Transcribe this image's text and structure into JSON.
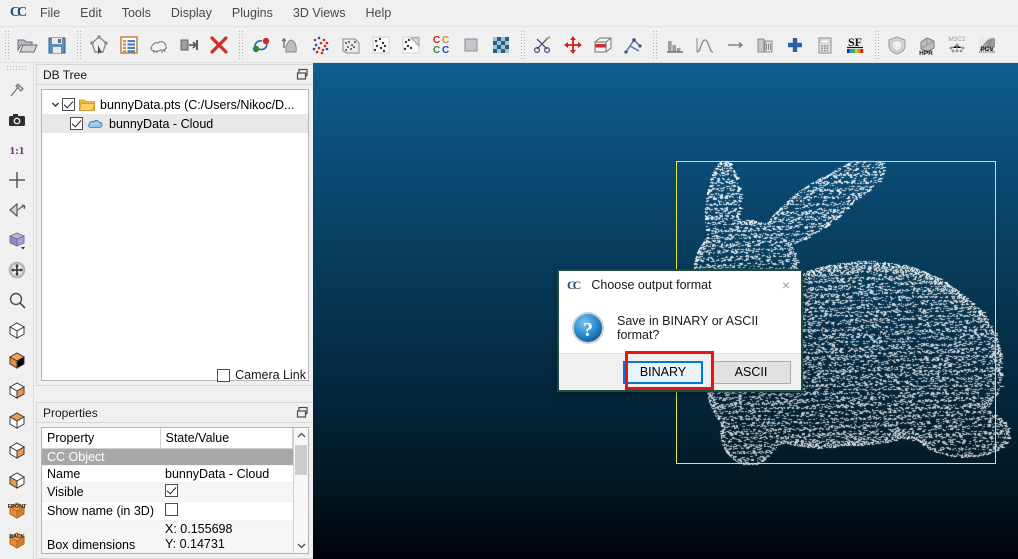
{
  "app": {
    "logo": "CC",
    "menu": [
      "File",
      "Edit",
      "Tools",
      "Display",
      "Plugins",
      "3D Views",
      "Help"
    ]
  },
  "toolbar": {
    "groups": [
      {
        "buttons": [
          {
            "name": "open-file-icon",
            "label": "Open"
          },
          {
            "name": "save-file-icon",
            "label": "Save"
          }
        ]
      },
      {
        "buttons": [
          {
            "name": "transform-icon",
            "label": "Apply transformation"
          },
          {
            "name": "properties-list-icon",
            "label": "Toggle properties"
          },
          {
            "name": "segment-mesh-icon",
            "label": "Segment"
          },
          {
            "name": "push-in-icon",
            "label": "Push"
          },
          {
            "name": "delete-icon",
            "label": "Delete"
          }
        ]
      },
      {
        "buttons": [
          {
            "name": "registration-icon",
            "label": "Register clouds"
          },
          {
            "name": "normals-icon",
            "label": "Compute normals"
          },
          {
            "name": "noise-filter-icon",
            "label": "Noise filter"
          },
          {
            "name": "mesh-sample-icon",
            "label": "Sample points on mesh"
          },
          {
            "name": "subsample-icon",
            "label": "Subsample"
          },
          {
            "name": "cloud-slice-icon",
            "label": "Slice"
          },
          {
            "name": "cloud-to-cloud-icon",
            "label": "Cloud/Cloud distance"
          },
          {
            "name": "cloud-to-mesh-icon",
            "label": "Cloud/Mesh distance"
          },
          {
            "name": "checkerboard-icon",
            "label": "Render"
          }
        ]
      },
      {
        "buttons": [
          {
            "name": "scissors-icon",
            "label": "Cut"
          },
          {
            "name": "translate-rotate-icon",
            "label": "Translate / Rotate"
          },
          {
            "name": "clipping-box-icon",
            "label": "Clipping box"
          },
          {
            "name": "align-points-icon",
            "label": "Align (point pairs picking)"
          }
        ]
      },
      {
        "buttons": [
          {
            "name": "histogram-icon",
            "label": "Histogram"
          },
          {
            "name": "gaussian-filter-icon",
            "label": "Gaussian filter"
          },
          {
            "name": "min-max-icon",
            "label": "Min / Max"
          },
          {
            "name": "delete-scalar-field-icon",
            "label": "Delete scalar field"
          },
          {
            "name": "add-scalar-field-icon",
            "label": "Add constant SF"
          },
          {
            "name": "calculator-icon",
            "label": "SF arithmetic"
          },
          {
            "name": "scalar-field-colors-icon",
            "label": "SF color scale"
          }
        ]
      },
      {
        "buttons": [
          {
            "name": "qhull-shield-icon",
            "label": "Hull plugin"
          },
          {
            "name": "hpr-icon",
            "label": "HPR"
          },
          {
            "name": "m3c2-icon",
            "label": "M3C2"
          },
          {
            "name": "pcv-icon",
            "label": "PCV"
          }
        ]
      }
    ]
  },
  "left_toolbar": {
    "buttons": [
      {
        "name": "pick-rotation-center-icon",
        "label": "Pick rotation center"
      },
      {
        "name": "camera-snapshot-icon",
        "label": "Render to file"
      },
      {
        "name": "zoom-one-to-one-icon",
        "label": "1:1"
      },
      {
        "name": "global-zoom-icon",
        "label": "Global zoom"
      },
      {
        "name": "toggle-orthographic-icon",
        "label": "Toggle perspective"
      },
      {
        "name": "default-view-cube-icon",
        "label": "Default view"
      },
      {
        "name": "pivot-center-icon",
        "label": "Pivot"
      },
      {
        "name": "zoom-magnifier-icon",
        "label": "Zoom"
      },
      {
        "name": "view-top-icon",
        "label": "Top view"
      },
      {
        "name": "view-bottom-icon",
        "label": "Bottom view"
      },
      {
        "name": "view-left-icon",
        "label": "Left view"
      },
      {
        "name": "view-right-icon",
        "label": "Right view"
      },
      {
        "name": "view-iso1-icon",
        "label": "Iso view 1"
      },
      {
        "name": "view-iso2-icon",
        "label": "Iso view 2"
      },
      {
        "name": "view-front-icon",
        "label": "FRONT"
      },
      {
        "name": "view-back-icon",
        "label": "BACK"
      }
    ],
    "front_label": "FRONT",
    "back_label": "BACK",
    "one_to_one_label": "1:1"
  },
  "db_tree": {
    "title": "DB Tree",
    "items": [
      {
        "label": "bunnyData.pts (C:/Users/Nikoc/D...",
        "checked": true,
        "expanded": true,
        "icon": "folder-icon",
        "level": 0,
        "selected": false
      },
      {
        "label": "bunnyData - Cloud",
        "checked": true,
        "icon": "cloud-icon",
        "level": 1,
        "selected": true
      }
    ],
    "camera_link_label": "Camera Link",
    "camera_link_checked": false
  },
  "properties": {
    "title": "Properties",
    "headers": [
      "Property",
      "State/Value"
    ],
    "rows": [
      {
        "type": "section",
        "key": "CC Object",
        "value": ""
      },
      {
        "type": "text",
        "key": "Name",
        "value": "bunnyData - Cloud"
      },
      {
        "type": "checkbox",
        "key": "Visible",
        "value": "",
        "checked": true
      },
      {
        "type": "checkbox",
        "key": "Show name (in 3D)",
        "value": "",
        "checked": false
      },
      {
        "type": "multiline",
        "key": "Box dimensions",
        "value": "X: 0.155698\nY: 0.14731"
      }
    ]
  },
  "view3d": {
    "bbox_color": "#e8e83c",
    "background_top": "#0e5e8f",
    "background_bottom": "#000307",
    "cloud_point_color": "#ffffff"
  },
  "dialog": {
    "logo": "CC",
    "title": "Choose output format",
    "close_label": "×",
    "icon": "question-mark-icon",
    "message": "Save in BINARY or ASCII format?",
    "buttons": [
      {
        "label": "BINARY",
        "primary": true,
        "name": "binary-button"
      },
      {
        "label": "ASCII",
        "primary": false,
        "name": "ascii-button"
      }
    ],
    "highlight_color": "#ee1111"
  }
}
